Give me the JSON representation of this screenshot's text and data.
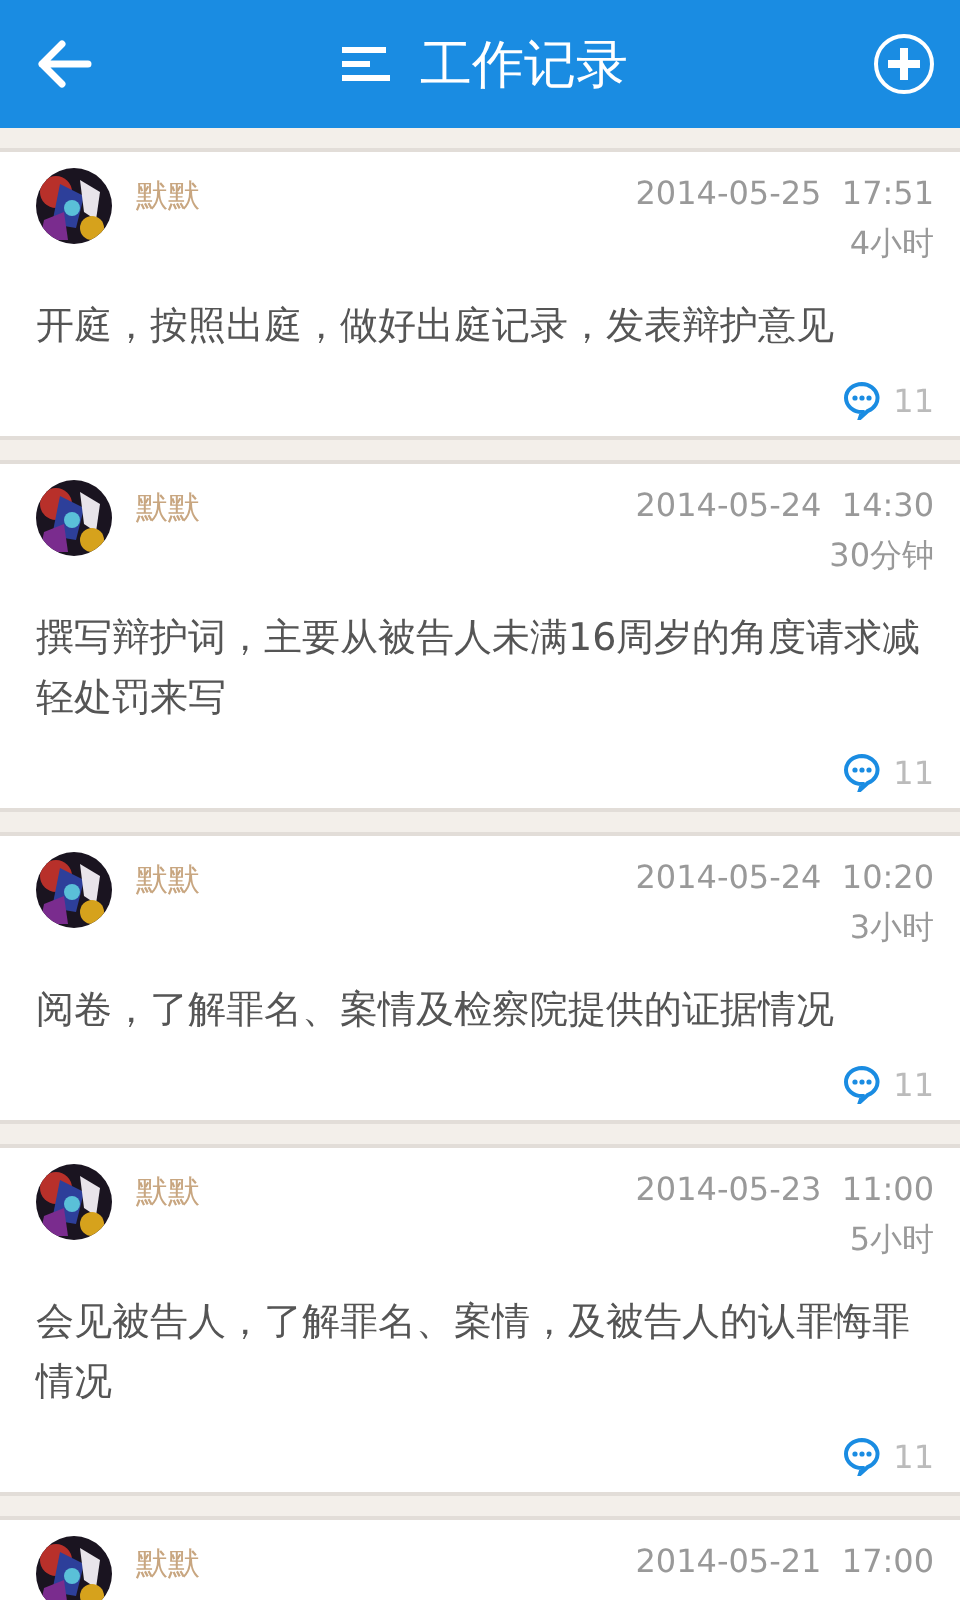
{
  "header": {
    "title": "工作记录"
  },
  "records": [
    {
      "author": "默默",
      "datetime": "2014-05-25  17:51",
      "duration": "4小时",
      "content": "开庭，按照出庭，做好出庭记录，发表辩护意见",
      "comments": "11"
    },
    {
      "author": "默默",
      "datetime": "2014-05-24  14:30",
      "duration": "30分钟",
      "content": "撰写辩护词，主要从被告人未满16周岁的角度请求减轻处罚来写",
      "comments": "11"
    },
    {
      "author": "默默",
      "datetime": "2014-05-24  10:20",
      "duration": "3小时",
      "content": "阅卷，了解罪名、案情及检察院提供的证据情况",
      "comments": "11"
    },
    {
      "author": "默默",
      "datetime": "2014-05-23  11:00",
      "duration": "5小时",
      "content": "会见被告人，了解罪名、案情，及被告人的认罪悔罪情况",
      "comments": "11"
    },
    {
      "author": "默默",
      "datetime": "2014-05-21  17:00"
    }
  ]
}
